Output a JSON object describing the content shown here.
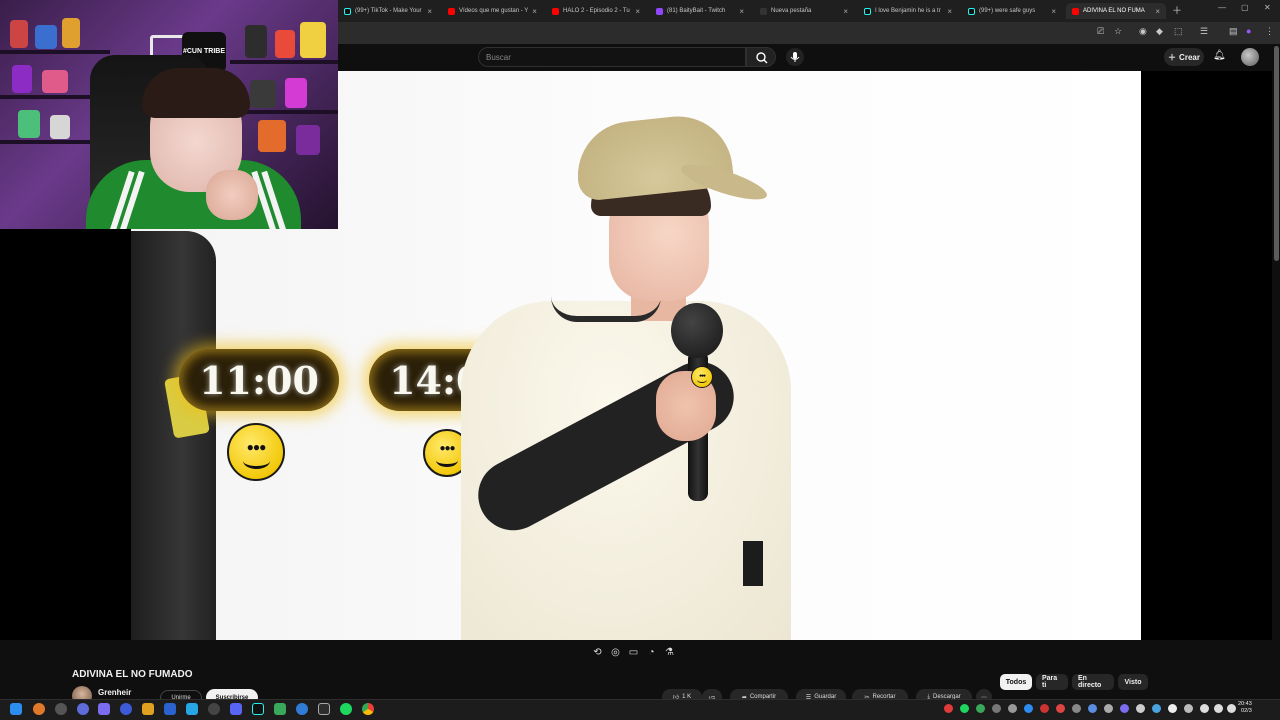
{
  "browser": {
    "tabs": [
      {
        "label": "(99+) TikTok - Make Your",
        "favicon_color": "#111111",
        "active": false
      },
      {
        "label": "Vídeos que me gustan - Y",
        "favicon_color": "#ff0000",
        "active": false
      },
      {
        "label": "HALO 2 - Episodio 2 - Tu",
        "favicon_color": "#ff0000",
        "active": false
      },
      {
        "label": "(81) BaityBait - Twitch",
        "favicon_color": "#9146ff",
        "active": false
      },
      {
        "label": "Nueva pestaña",
        "favicon_color": "#333333",
        "active": false
      },
      {
        "label": "I love Benjamin he is a tr",
        "favicon_color": "#111111",
        "active": false
      },
      {
        "label": "(99+) were safe guys",
        "favicon_color": "#111111",
        "active": false
      },
      {
        "label": "ADIVINA EL NO FUMA",
        "favicon_color": "#ff0000",
        "active": true
      }
    ],
    "new_tab_icon": "plus-icon"
  },
  "youtube": {
    "search_placeholder": "Buscar",
    "create_label": "Crear",
    "accent": "#ff0000"
  },
  "video_overlay": {
    "times": [
      "11:00",
      "14:00"
    ]
  },
  "webcam": {
    "shirt_text": "#CUN TRIBE"
  },
  "video": {
    "title": "ADIVINA EL NO FUMADO",
    "channel": "Grenheir",
    "join_label": "Unirme",
    "subscribe_label": "Suscribirse",
    "actions": [
      {
        "label": "1 K",
        "icon": "like-icon"
      },
      {
        "label": "",
        "icon": "dislike-icon"
      },
      {
        "label": "Compartir",
        "icon": "share-icon"
      },
      {
        "label": "Guardar",
        "icon": "save-icon"
      },
      {
        "label": "Recortar",
        "icon": "clip-icon"
      },
      {
        "label": "Descargar",
        "icon": "download-icon"
      }
    ]
  },
  "chips": [
    {
      "label": "Todos",
      "selected": true
    },
    {
      "label": "Para ti",
      "selected": false
    },
    {
      "label": "En directo",
      "selected": false
    },
    {
      "label": "Visto",
      "selected": false
    }
  ],
  "taskbar": {
    "clock_time": "20:43",
    "clock_date": "02/3"
  }
}
